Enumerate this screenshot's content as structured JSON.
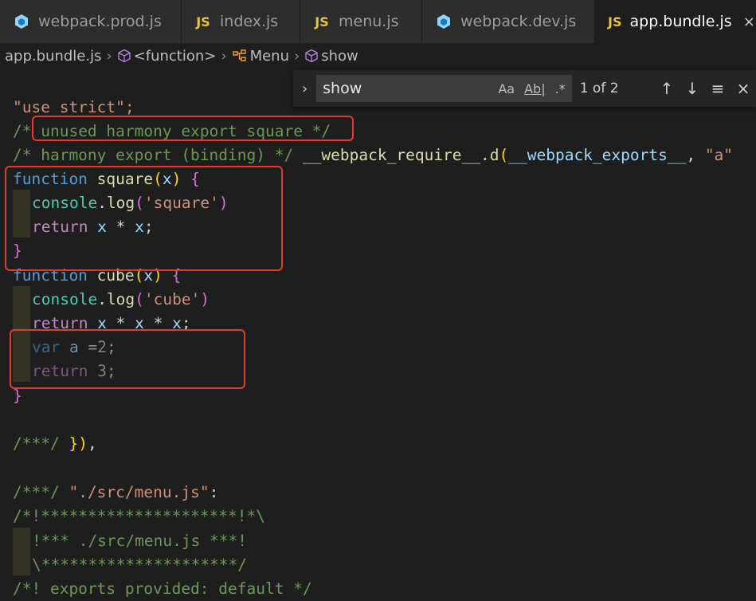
{
  "tabs": [
    {
      "label": "webpack.prod.js",
      "icon": "webpack-icon"
    },
    {
      "label": "index.js",
      "icon": "JS"
    },
    {
      "label": "menu.js",
      "icon": "JS"
    },
    {
      "label": "webpack.dev.js",
      "icon": "webpack-icon"
    },
    {
      "label": "app.bundle.js",
      "icon": "JS",
      "active": true
    }
  ],
  "close_glyph": "×",
  "breadcrumb": [
    "app.bundle.js",
    "<function>",
    "Menu",
    "show"
  ],
  "find": {
    "query": "show",
    "match_case": "Aa",
    "whole_word": "Ab|",
    "regex": ".*",
    "result": "1 of 2"
  },
  "code": {
    "l0": [
      "\"use strict\";"
    ],
    "l1": [
      "/* ",
      "unused harmony export square */"
    ],
    "l2": [
      "/* harmony export (binding) */ ",
      "__webpack_require__",
      ".",
      "d",
      "(",
      "__webpack_exports__",
      ", ",
      "\"a\""
    ],
    "l3": [
      "function ",
      "square",
      "(",
      "x",
      ") ",
      "{"
    ],
    "l4": [
      "console",
      ".",
      "log",
      "(",
      "'square'",
      ")"
    ],
    "l5": [
      "return ",
      "x",
      " * ",
      "x",
      ";"
    ],
    "l6": [
      "}"
    ],
    "l7": [
      "function ",
      "cube",
      "(",
      "x",
      ") ",
      "{"
    ],
    "l8": [
      "console",
      ".",
      "log",
      "(",
      "'cube'",
      ")"
    ],
    "l9": [
      "return ",
      "x",
      " * ",
      "x",
      " * ",
      "x",
      ";"
    ],
    "l10": [
      "var ",
      "a",
      " =",
      "2",
      ";"
    ],
    "l11": [
      "return ",
      "3",
      ";"
    ],
    "l12": [
      "}"
    ],
    "l14": [
      "/***/ ",
      "}",
      ")",
      ","
    ],
    "l16": [
      "/***/ ",
      "\"./src/menu.js\"",
      ":"
    ],
    "l17": [
      "/*!*********************!*\\"
    ],
    "l18": [
      "!*** ./src/menu.js ***!"
    ],
    "l19": [
      "\\*********************/"
    ],
    "l20": [
      "/*! exports provided: default */"
    ]
  }
}
